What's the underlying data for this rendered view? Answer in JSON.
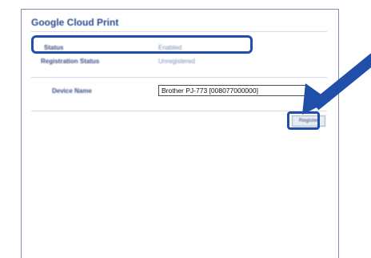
{
  "panel": {
    "title": "Google Cloud Print"
  },
  "rows": {
    "status_label": "Status",
    "status_value": "Enabled",
    "registration_label": "Registration Status",
    "registration_value": "Unregistered",
    "device_name_label": "Device Name",
    "device_name_value": "Brother PJ-773 [008077000000]"
  },
  "buttons": {
    "register_label": "Register"
  },
  "colors": {
    "accent": "#1f4fa8",
    "title": "#2e4a8b",
    "label": "#3a4f86",
    "value": "#7c8fbf"
  },
  "icons": {
    "pointer": "arrow-pointer-icon"
  }
}
